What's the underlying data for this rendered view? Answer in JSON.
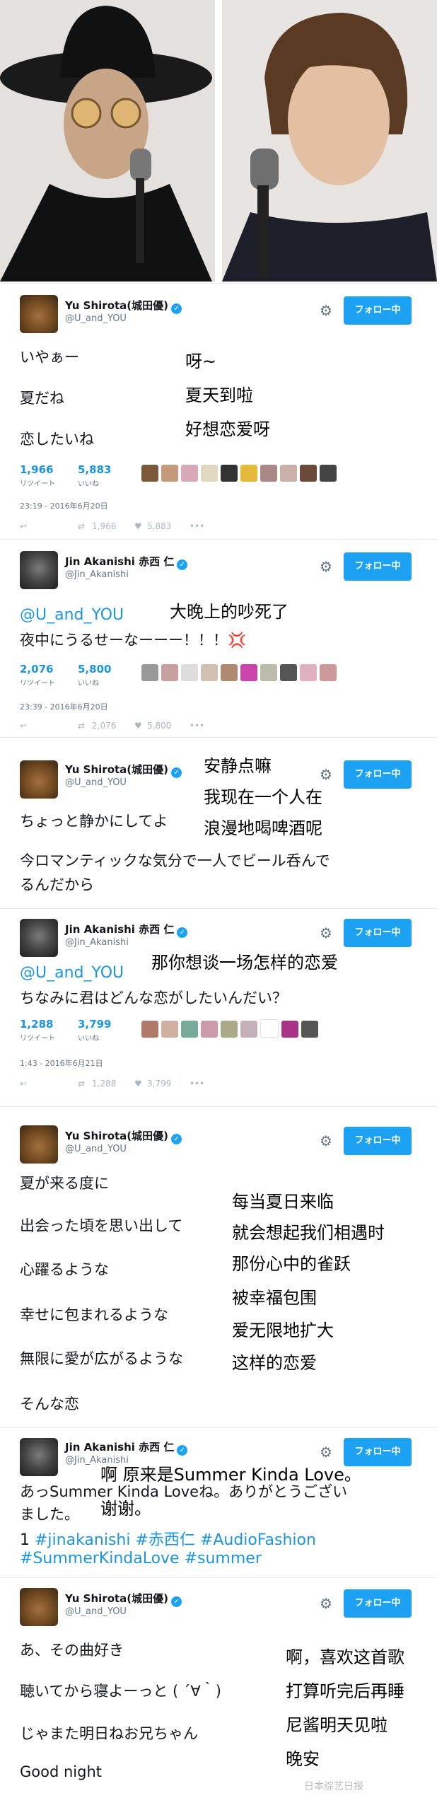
{
  "follow_label": "フォロー中",
  "colors": {
    "accent": "#1da1f2",
    "link": "#1b95e0"
  },
  "tweets": [
    {
      "name": "Yu Shirota(城田優)",
      "handle": "@U_and_YOU",
      "lines": [
        "いやぁー",
        "夏だね",
        "恋したいね"
      ],
      "cn": [
        "呀~",
        "夏天到啦",
        "好想恋爱呀"
      ],
      "retweets": "1,966",
      "retweets_label": "リツイート",
      "likes": "5,883",
      "likes_label": "いいね",
      "date": "23:19 - 2016年6月20日",
      "act_rt": "1,966",
      "act_like": "5,883"
    },
    {
      "name": "Jin Akanishi 赤西 仁",
      "handle": "@Jin_Akanishi",
      "mention": "@U_and_YOU",
      "lines": [
        "夜中にうるせーなーーー！！！💢"
      ],
      "cn": [
        "大晚上的吵死了"
      ],
      "retweets": "2,076",
      "retweets_label": "リツイート",
      "likes": "5,800",
      "likes_label": "いいね",
      "date": "23:39 - 2016年6月20日",
      "act_rt": "2,076",
      "act_like": "5,800"
    },
    {
      "name": "Yu Shirota(城田優)",
      "handle": "@U_and_YOU",
      "lines": [
        "ちょっと静かにしてよ",
        "今ロマンティックな気分で一人でビール呑んで",
        "るんだから"
      ],
      "cn": [
        "安静点嘛",
        "我现在一个人在",
        "浪漫地喝啤酒呢"
      ]
    },
    {
      "name": "Jin Akanishi 赤西 仁",
      "handle": "@Jin_Akanishi",
      "mention": "@U_and_YOU",
      "lines": [
        "ちなみに君はどんな恋がしたいんだい？"
      ],
      "cn": [
        "那你想谈一场怎样的恋爱"
      ],
      "retweets": "1,288",
      "retweets_label": "リツイート",
      "likes": "3,799",
      "likes_label": "いいね",
      "date": "1:43 - 2016年6月21日",
      "act_rt": "1,288",
      "act_like": "3,799"
    },
    {
      "name": "Yu Shirota(城田優)",
      "handle": "@U_and_YOU",
      "lines": [
        "夏が来る度に",
        "出会った頃を思い出して",
        "心躍るような",
        "幸せに包まれるような",
        "無限に愛が広がるような",
        "そんな恋"
      ],
      "cn": [
        "每当夏日来临",
        "就会想起我们相遇时",
        "那份心中的雀跃",
        "被幸福包围",
        "爱无限地扩大",
        "这样的恋爱"
      ]
    },
    {
      "name": "Jin Akanishi 赤西 仁",
      "handle": "@Jin_Akanishi",
      "lines": [
        "あっSummer Kinda Loveね。ありがとうござい",
        "ました。"
      ],
      "cn": [
        "啊 原来是Summer Kinda Love。",
        "谢谢。"
      ],
      "hashtags1": "#jinakanishi #赤西仁 #AudioFashion",
      "hashtags1_prefix": "1 ",
      "hashtags2": "#SummerKindaLove #summer"
    },
    {
      "name": "Yu Shirota(城田優)",
      "handle": "@U_and_YOU",
      "lines": [
        "あ、その曲好き",
        "聴いてから寝よーっと ( ´∀｀)",
        "じゃまた明日ねお兄ちゃん",
        "Good night"
      ],
      "cn": [
        "啊，喜欢这首歌",
        "打算听完后再睡",
        "尼酱明天见啦",
        "晚安"
      ]
    }
  ],
  "watermark": "日本综艺日报"
}
